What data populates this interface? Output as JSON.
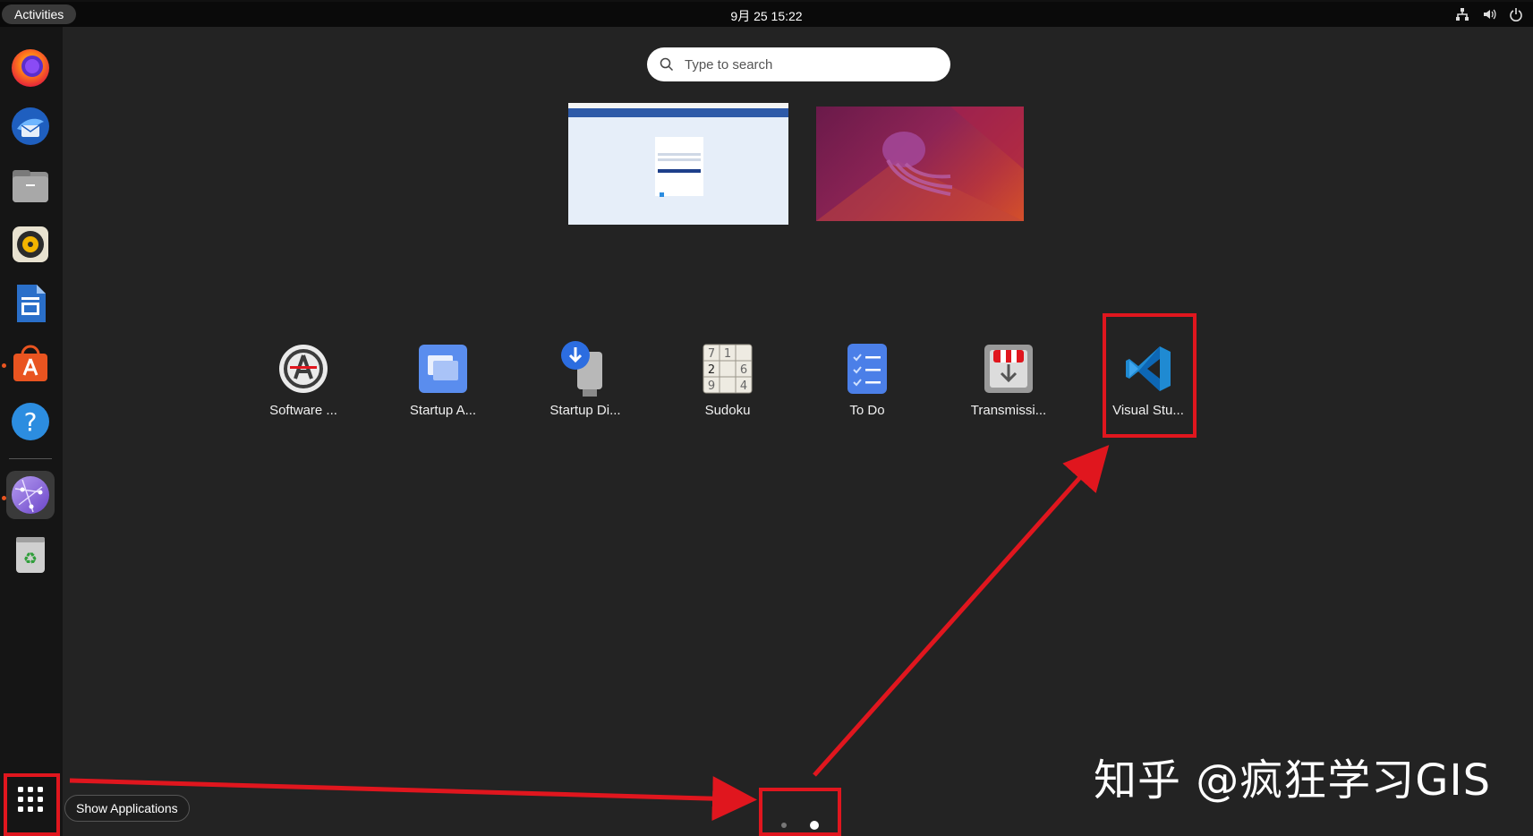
{
  "topbar": {
    "activities_label": "Activities",
    "clock": "9月 25  15:22",
    "tray_icons": [
      "network-icon",
      "volume-icon",
      "power-icon"
    ]
  },
  "dock": {
    "items": [
      {
        "name": "firefox",
        "icon": "firefox-icon",
        "running": false
      },
      {
        "name": "thunderbird",
        "icon": "thunderbird-icon",
        "running": false
      },
      {
        "name": "files",
        "icon": "files-icon",
        "running": false
      },
      {
        "name": "rhythmbox",
        "icon": "rhythmbox-icon",
        "running": false
      },
      {
        "name": "libreoffice-writer",
        "icon": "writer-icon",
        "running": false
      },
      {
        "name": "app-center",
        "icon": "app-center-icon",
        "running": true
      },
      {
        "name": "help",
        "icon": "help-icon",
        "running": false
      },
      {
        "name": "browser-app",
        "icon": "globe-icon",
        "running": true,
        "active": true
      },
      {
        "name": "trash",
        "icon": "trash-icon",
        "running": false
      }
    ],
    "show_apps_tooltip": "Show Applications"
  },
  "search": {
    "placeholder": "Type to search",
    "value": ""
  },
  "apps": [
    {
      "label": "Software ...",
      "icon": "software-updater-icon"
    },
    {
      "label": "Startup A...",
      "icon": "startup-applications-icon"
    },
    {
      "label": "Startup Di...",
      "icon": "startup-disk-creator-icon"
    },
    {
      "label": "Sudoku",
      "icon": "sudoku-icon"
    },
    {
      "label": "To Do",
      "icon": "todo-icon"
    },
    {
      "label": "Transmissi...",
      "icon": "transmission-icon"
    },
    {
      "label": "Visual Stu...",
      "icon": "vscode-icon"
    }
  ],
  "pager": {
    "pages": 2,
    "current": 2
  },
  "sudoku_digits": [
    "7",
    "1",
    "2",
    "6",
    "9",
    "4"
  ],
  "watermark": "知乎 @疯狂学习GIS",
  "colors": {
    "highlight": "#e0161e",
    "accent": "#e95420"
  }
}
